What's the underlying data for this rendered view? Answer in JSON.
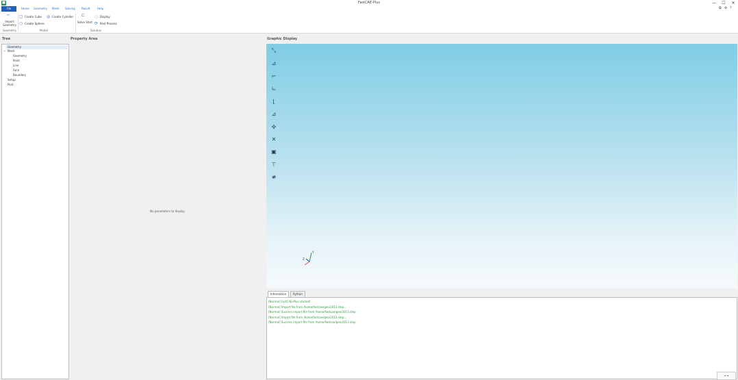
{
  "app": {
    "title": "FastCAE-Plus",
    "icon": "app-icon"
  },
  "window": {
    "minimize": "—",
    "maximize": "☐",
    "close": "✕"
  },
  "menu": {
    "file": "File",
    "items": [
      "Home",
      "Geometry",
      "Mesh",
      "Solving",
      "Result",
      "Help"
    ]
  },
  "ribbon": {
    "import_geometry": "Import Geometry",
    "create_cube": "Create Cube",
    "create_cylinder": "Create Cylinder",
    "create_sphere": "Create Sphere",
    "solve_label": "Solve Start",
    "display": "Display",
    "post_process": "Post Process",
    "groups": [
      "Geometry",
      "Model",
      "Solution"
    ]
  },
  "panels": {
    "tree": "Tree",
    "property": "Property Area",
    "graphic": "Graphic Display"
  },
  "tree": {
    "geometry": "Geometry",
    "mesh": "Mesh",
    "mesh_children": [
      "Geometry",
      "Point",
      "Line",
      "Face",
      "Boundary"
    ],
    "setup": "Setup",
    "post": "Post"
  },
  "property": {
    "message": "No parameters to display"
  },
  "toolbar_icons": [
    "fit-view-icon",
    "front-view-icon",
    "back-view-icon",
    "top-view-icon",
    "bottom-view-icon",
    "left-view-icon",
    "right-view-icon",
    "iso-view-icon",
    "screenshot-icon",
    "point-tool-icon",
    "align-tool-icon"
  ],
  "axes": {
    "y": "Y",
    "z": "Z"
  },
  "console": {
    "tabs": [
      "Information",
      "Python"
    ],
    "logs": [
      "[Normal] FastCAE-Plus started!",
      "[Normal] Import file from /home/fastcae/geo/2013.step...",
      "[Normal] Success import file from /home/fastcae/geo/2013.step",
      "[Normal] Import file from /home/fastcae/geo/2013.step...",
      "[Normal] Success import file from /home/fastcae/geo/2013.step"
    ],
    "corner_button": "≡ ▾"
  },
  "colors": {
    "accent": "#1e5fbf",
    "log": "#2f9a3f",
    "sky_top": "#7fcde5"
  }
}
